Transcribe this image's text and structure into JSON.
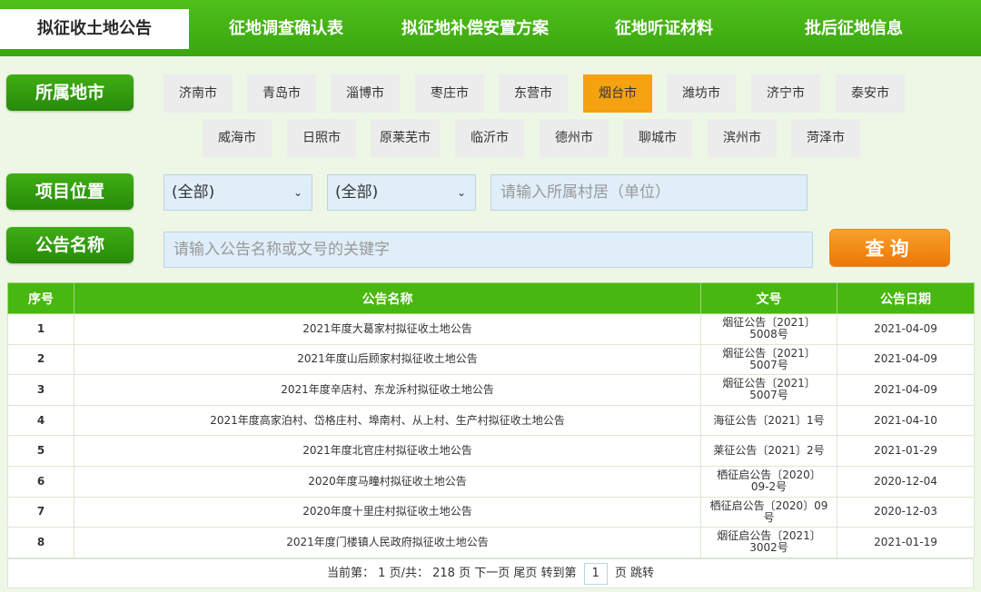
{
  "tabs": [
    {
      "label": "拟征收土地公告"
    },
    {
      "label": "征地调查确认表"
    },
    {
      "label": "拟征地补偿安置方案"
    },
    {
      "label": "征地听证材料"
    },
    {
      "label": "批后征地信息"
    }
  ],
  "filters": {
    "city_label": "所属地市",
    "location_label": "项目位置",
    "name_label": "公告名称",
    "cities_row1": [
      "济南市",
      "青岛市",
      "淄博市",
      "枣庄市",
      "东营市",
      "烟台市",
      "潍坊市",
      "济宁市",
      "泰安市"
    ],
    "cities_row2": [
      "威海市",
      "日照市",
      "原莱芜市",
      "临沂市",
      "德州市",
      "聊城市",
      "滨州市",
      "菏泽市"
    ],
    "active_city": "烟台市",
    "select1": "(全部)",
    "select2": "(全部)",
    "village_placeholder": "请输入所属村居（单位）",
    "name_placeholder": "请输入公告名称或文号的关键字",
    "query_label": "查询"
  },
  "table": {
    "headers": [
      "序号",
      "公告名称",
      "文号",
      "公告日期"
    ],
    "rows": [
      [
        "1",
        "2021年度大葛家村拟征收土地公告",
        "烟征公告〔2021〕5008号",
        "2021-04-09"
      ],
      [
        "2",
        "2021年度山后顾家村拟征收土地公告",
        "烟征公告〔2021〕5007号",
        "2021-04-09"
      ],
      [
        "3",
        "2021年度辛店村、东龙泝村拟征收土地公告",
        "烟征公告〔2021〕5007号",
        "2021-04-09"
      ],
      [
        "4",
        "2021年度高家泊村、岱格庄村、埠南村、从上村、生产村拟征收土地公告",
        "海征公告〔2021〕1号",
        "2021-04-10"
      ],
      [
        "5",
        "2021年度北官庄村拟征收土地公告",
        "莱征公告〔2021〕2号",
        "2021-01-29"
      ],
      [
        "6",
        "2020年度马疃村拟征收土地公告",
        "栖征启公告〔2020〕09-2号",
        "2020-12-04"
      ],
      [
        "7",
        "2020年度十里庄村拟征收土地公告",
        "栖征启公告〔2020〕09号",
        "2020-12-03"
      ],
      [
        "8",
        "2021年度门楼镇人民政府拟征收土地公告",
        "烟征启公告〔2021〕3002号",
        "2021-01-19"
      ]
    ]
  },
  "pager": {
    "current_prefix": "当前第：",
    "current_page": "1",
    "total_mid": "页/共：",
    "total_pages": "218",
    "total_suffix": "页",
    "next": "下一页",
    "last": "尾页",
    "goto_prefix": "转到第",
    "goto_value": "1",
    "goto_suffix": "页",
    "jump": "跳转"
  }
}
